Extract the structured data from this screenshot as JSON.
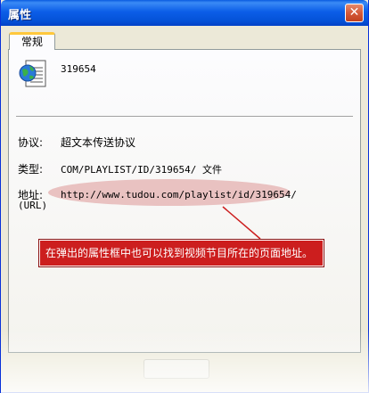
{
  "window": {
    "title": "属性",
    "close_glyph": "✕"
  },
  "tabs": [
    {
      "label": "常规"
    }
  ],
  "file": {
    "icon": "html-document-globe-icon",
    "name": "319654"
  },
  "properties": {
    "protocol_label": "协议:",
    "protocol_value": "超文本传送协议",
    "type_label": "类型:",
    "type_value": "COM/PLAYLIST/ID/319654/ 文件",
    "address_label": "地址:",
    "address_sublabel": "(URL)",
    "address_value": "http://www.tudou.com/playlist/id/319654/"
  },
  "annotation": {
    "text": "在弹出的属性框中也可以找到视频节目所在的页面地址。",
    "color": "#cc1e1e"
  }
}
